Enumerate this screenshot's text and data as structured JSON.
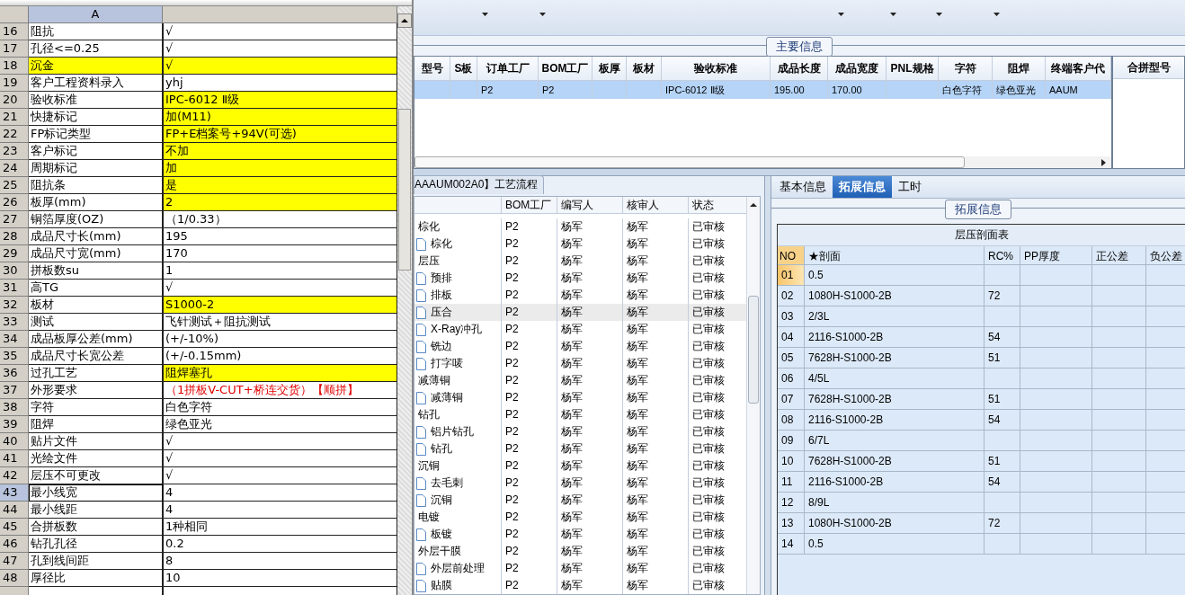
{
  "sheet": {
    "columns": [
      "A"
    ],
    "rows": [
      {
        "num": "16",
        "label": "阻抗",
        "value": "√",
        "label_highlighted": false,
        "value_highlighted": false,
        "alert": false,
        "selected": false
      },
      {
        "num": "17",
        "label": "孔径<=0.25",
        "value": "√",
        "label_highlighted": false,
        "value_highlighted": false,
        "alert": false,
        "selected": false
      },
      {
        "num": "18",
        "label": "沉金",
        "value": "√",
        "label_highlighted": true,
        "value_highlighted": true,
        "alert": false,
        "selected": false
      },
      {
        "num": "19",
        "label": "客户工程资料录入",
        "value": "yhj",
        "label_highlighted": false,
        "value_highlighted": false,
        "alert": false,
        "selected": false
      },
      {
        "num": "20",
        "label": "验收标准",
        "value": "IPC-6012  Ⅱ级",
        "label_highlighted": false,
        "value_highlighted": true,
        "alert": false,
        "selected": false
      },
      {
        "num": "21",
        "label": "快捷标记",
        "value": "加(M11)",
        "label_highlighted": false,
        "value_highlighted": true,
        "alert": false,
        "selected": false
      },
      {
        "num": "22",
        "label": "FP标记类型",
        "value": "FP+E档案号+94V(可选)",
        "label_highlighted": false,
        "value_highlighted": true,
        "alert": false,
        "selected": false
      },
      {
        "num": "23",
        "label": "客户标记",
        "value": "不加",
        "label_highlighted": false,
        "value_highlighted": true,
        "alert": false,
        "selected": false
      },
      {
        "num": "24",
        "label": "周期标记",
        "value": "加",
        "label_highlighted": false,
        "value_highlighted": true,
        "alert": false,
        "selected": false
      },
      {
        "num": "25",
        "label": "阻抗条",
        "value": "是",
        "label_highlighted": false,
        "value_highlighted": true,
        "alert": false,
        "selected": false
      },
      {
        "num": "26",
        "label": "板厚(mm)",
        "value": "2",
        "label_highlighted": false,
        "value_highlighted": true,
        "alert": false,
        "selected": false
      },
      {
        "num": "27",
        "label": "铜箔厚度(OZ)",
        "value": "（1/0.33）",
        "label_highlighted": false,
        "value_highlighted": false,
        "alert": false,
        "selected": false
      },
      {
        "num": "28",
        "label": "成品尺寸长(mm)",
        "value": "195",
        "label_highlighted": false,
        "value_highlighted": false,
        "alert": false,
        "selected": false
      },
      {
        "num": "29",
        "label": "成品尺寸宽(mm)",
        "value": "170",
        "label_highlighted": false,
        "value_highlighted": false,
        "alert": false,
        "selected": false
      },
      {
        "num": "30",
        "label": "拼板数su",
        "value": "1",
        "label_highlighted": false,
        "value_highlighted": false,
        "alert": false,
        "selected": false
      },
      {
        "num": "31",
        "label": "高TG",
        "value": "√",
        "label_highlighted": false,
        "value_highlighted": false,
        "alert": false,
        "selected": false
      },
      {
        "num": "32",
        "label": "板材",
        "value": "S1000-2",
        "label_highlighted": false,
        "value_highlighted": true,
        "alert": false,
        "selected": false
      },
      {
        "num": "33",
        "label": "测试",
        "value": "飞针测试＋阻抗测试",
        "label_highlighted": false,
        "value_highlighted": false,
        "alert": false,
        "selected": false
      },
      {
        "num": "34",
        "label": "成品板厚公差(mm)",
        "value": "(+/-10%)",
        "label_highlighted": false,
        "value_highlighted": false,
        "alert": false,
        "selected": false
      },
      {
        "num": "35",
        "label": "成品尺寸长宽公差",
        "value": "(+/-0.15mm)",
        "label_highlighted": false,
        "value_highlighted": false,
        "alert": false,
        "selected": false
      },
      {
        "num": "36",
        "label": "过孔工艺",
        "value": "阻焊塞孔",
        "label_highlighted": false,
        "value_highlighted": true,
        "alert": false,
        "selected": false
      },
      {
        "num": "37",
        "label": "外形要求",
        "value": "（1拼板V-CUT+桥连交货）【顺拼】",
        "label_highlighted": false,
        "value_highlighted": false,
        "alert": true,
        "selected": false
      },
      {
        "num": "38",
        "label": "字符",
        "value": "白色字符",
        "label_highlighted": false,
        "value_highlighted": false,
        "alert": false,
        "selected": false
      },
      {
        "num": "39",
        "label": "阻焊",
        "value": "绿色亚光",
        "label_highlighted": false,
        "value_highlighted": false,
        "alert": false,
        "selected": false
      },
      {
        "num": "40",
        "label": "贴片文件",
        "value": "√",
        "label_highlighted": false,
        "value_highlighted": false,
        "alert": false,
        "selected": false
      },
      {
        "num": "41",
        "label": "光绘文件",
        "value": "√",
        "label_highlighted": false,
        "value_highlighted": false,
        "alert": false,
        "selected": false
      },
      {
        "num": "42",
        "label": "层压不可更改",
        "value": "√",
        "label_highlighted": false,
        "value_highlighted": false,
        "alert": false,
        "selected": false
      },
      {
        "num": "43",
        "label": "最小线宽",
        "value": "4",
        "label_highlighted": false,
        "value_highlighted": false,
        "alert": false,
        "selected": true
      },
      {
        "num": "44",
        "label": "最小线距",
        "value": "4",
        "label_highlighted": false,
        "value_highlighted": false,
        "alert": false,
        "selected": false
      },
      {
        "num": "45",
        "label": "合拼板数",
        "value": "1种相同",
        "label_highlighted": false,
        "value_highlighted": false,
        "alert": false,
        "selected": false
      },
      {
        "num": "46",
        "label": "钻孔孔径",
        "value": "0.2",
        "label_highlighted": false,
        "value_highlighted": false,
        "alert": false,
        "selected": false
      },
      {
        "num": "47",
        "label": "孔到线间距",
        "value": "8",
        "label_highlighted": false,
        "value_highlighted": false,
        "alert": false,
        "selected": false
      },
      {
        "num": "48",
        "label": "厚径比",
        "value": "10",
        "label_highlighted": false,
        "value_highlighted": false,
        "alert": false,
        "selected": false
      }
    ]
  },
  "main_info": {
    "title": "主要信息",
    "columns": [
      "型号",
      "S板",
      "订单工厂",
      "BOM工厂",
      "板厚",
      "板材",
      "验收标准",
      "成品长度",
      "成品宽度",
      "PNL规格",
      "字符",
      "阻焊",
      "终端客户代"
    ],
    "rows": [
      {
        "selected": true,
        "cells": [
          null,
          null,
          "P2",
          "P2",
          null,
          null,
          "IPC-6012 Ⅱ级",
          "195.00",
          "170.00",
          null,
          "白色字符",
          "绿色亚光",
          "AAUM"
        ]
      }
    ],
    "side_column": "合拼型号"
  },
  "process": {
    "tab": "AAAUM002A0】工艺流程",
    "columns": [
      "BOM工厂",
      "编写人",
      "核审人",
      "状态"
    ],
    "rows": [
      {
        "name": "棕化",
        "factory": "P2",
        "writer": "杨军",
        "reviewer": "杨军",
        "status": "已审核",
        "selected": false,
        "children": [
          {
            "name": "棕化",
            "factory": "P2",
            "writer": "杨军",
            "reviewer": "杨军",
            "status": "已审核",
            "selected": false
          }
        ]
      },
      {
        "name": "层压",
        "factory": "P2",
        "writer": "杨军",
        "reviewer": "杨军",
        "status": "已审核",
        "selected": false,
        "children": [
          {
            "name": "预排",
            "factory": "P2",
            "writer": "杨军",
            "reviewer": "杨军",
            "status": "已审核",
            "selected": false
          },
          {
            "name": "排板",
            "factory": "P2",
            "writer": "杨军",
            "reviewer": "杨军",
            "status": "已审核",
            "selected": false
          },
          {
            "name": "压合",
            "factory": "P2",
            "writer": "杨军",
            "reviewer": "杨军",
            "status": "已审核",
            "selected": true
          },
          {
            "name": "X-Ray冲孔",
            "factory": "P2",
            "writer": "杨军",
            "reviewer": "杨军",
            "status": "已审核",
            "selected": false
          },
          {
            "name": "铣边",
            "factory": "P2",
            "writer": "杨军",
            "reviewer": "杨军",
            "status": "已审核",
            "selected": false
          },
          {
            "name": "打字唛",
            "factory": "P2",
            "writer": "杨军",
            "reviewer": "杨军",
            "status": "已审核",
            "selected": false
          }
        ]
      },
      {
        "name": "减薄铜",
        "factory": "P2",
        "writer": "杨军",
        "reviewer": "杨军",
        "status": "已审核",
        "selected": false,
        "children": [
          {
            "name": "减薄铜",
            "factory": "P2",
            "writer": "杨军",
            "reviewer": "杨军",
            "status": "已审核",
            "selected": false
          }
        ]
      },
      {
        "name": "钻孔",
        "factory": "P2",
        "writer": "杨军",
        "reviewer": "杨军",
        "status": "已审核",
        "selected": false,
        "children": [
          {
            "name": "铝片钻孔",
            "factory": "P2",
            "writer": "杨军",
            "reviewer": "杨军",
            "status": "已审核",
            "selected": false
          },
          {
            "name": "钻孔",
            "factory": "P2",
            "writer": "杨军",
            "reviewer": "杨军",
            "status": "已审核",
            "selected": false
          }
        ]
      },
      {
        "name": "沉铜",
        "factory": "P2",
        "writer": "杨军",
        "reviewer": "杨军",
        "status": "已审核",
        "selected": false,
        "children": [
          {
            "name": "去毛刺",
            "factory": "P2",
            "writer": "杨军",
            "reviewer": "杨军",
            "status": "已审核",
            "selected": false
          },
          {
            "name": "沉铜",
            "factory": "P2",
            "writer": "杨军",
            "reviewer": "杨军",
            "status": "已审核",
            "selected": false
          }
        ]
      },
      {
        "name": "电镀",
        "factory": "P2",
        "writer": "杨军",
        "reviewer": "杨军",
        "status": "已审核",
        "selected": false,
        "children": [
          {
            "name": "板镀",
            "factory": "P2",
            "writer": "杨军",
            "reviewer": "杨军",
            "status": "已审核",
            "selected": false
          }
        ]
      },
      {
        "name": "外层干膜",
        "factory": "P2",
        "writer": "杨军",
        "reviewer": "杨军",
        "status": "已审核",
        "selected": false,
        "children": [
          {
            "name": "外层前处理",
            "factory": "P2",
            "writer": "杨军",
            "reviewer": "杨军",
            "status": "已审核",
            "selected": false
          },
          {
            "name": "贴膜",
            "factory": "P2",
            "writer": "杨军",
            "reviewer": "杨军",
            "status": "已审核",
            "selected": false
          }
        ]
      }
    ]
  },
  "detail": {
    "tabs": [
      {
        "label": "基本信息",
        "selected": false
      },
      {
        "label": "拓展信息",
        "selected": true
      },
      {
        "label": "工时",
        "selected": false
      }
    ],
    "group": "拓展信息",
    "table_title": "层压剖面表",
    "columns": [
      "NO",
      "★剖面",
      "RC%",
      "PP厚度",
      "正公差",
      "负公差"
    ],
    "rows": [
      {
        "no": "01",
        "section": "0.5",
        "selected": true
      },
      {
        "no": "02",
        "section": "1080H-S1000-2B",
        "rc": "72",
        "selected": false
      },
      {
        "no": "03",
        "section": "2/3L",
        "selected": false
      },
      {
        "no": "04",
        "section": "2116-S1000-2B",
        "rc": "54",
        "selected": false
      },
      {
        "no": "05",
        "section": "7628H-S1000-2B",
        "rc": "51",
        "selected": false
      },
      {
        "no": "06",
        "section": "4/5L",
        "selected": false
      },
      {
        "no": "07",
        "section": "7628H-S1000-2B",
        "rc": "51",
        "selected": false
      },
      {
        "no": "08",
        "section": "2116-S1000-2B",
        "rc": "54",
        "selected": false
      },
      {
        "no": "09",
        "section": "6/7L",
        "selected": false
      },
      {
        "no": "10",
        "section": "7628H-S1000-2B",
        "rc": "51",
        "selected": false
      },
      {
        "no": "11",
        "section": "2116-S1000-2B",
        "rc": "54",
        "selected": false
      },
      {
        "no": "12",
        "section": "8/9L",
        "selected": false
      },
      {
        "no": "13",
        "section": "1080H-S1000-2B",
        "rc": "72",
        "selected": false
      },
      {
        "no": "14",
        "section": "0.5",
        "selected": false
      }
    ]
  }
}
